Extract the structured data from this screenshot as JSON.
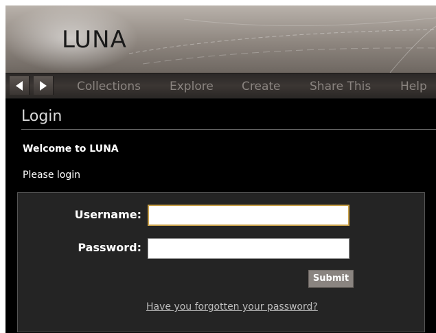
{
  "header": {
    "logo": "LUNA"
  },
  "nav": {
    "back_icon": "chevron-left-icon",
    "forward_icon": "chevron-right-icon",
    "items": [
      "Collections",
      "Explore",
      "Create",
      "Share This",
      "Help"
    ]
  },
  "main": {
    "title": "Login",
    "welcome": "Welcome to LUNA",
    "instruction": "Please login"
  },
  "form": {
    "username_label": "Username:",
    "username_value": "",
    "password_label": "Password:",
    "password_value": "",
    "submit_label": "Submit",
    "forgot_link": "Have you forgotten your password?"
  },
  "colors": {
    "background": "#000000",
    "accent_focus": "#c9a14a",
    "nav_text": "#8a8480",
    "panel": "#242424"
  }
}
